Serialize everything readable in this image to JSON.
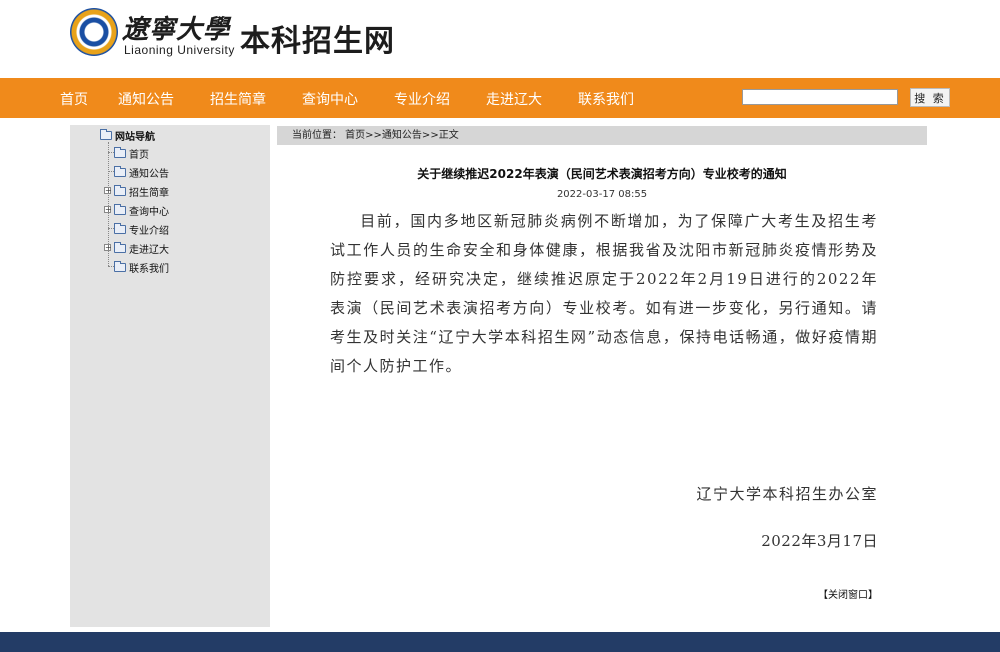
{
  "header": {
    "logo_cn": "遼寧大學",
    "logo_en": "Liaoning University",
    "site_title": "本科招生网"
  },
  "nav": {
    "items": [
      "首页",
      "通知公告",
      "招生简章",
      "查询中心",
      "专业介绍",
      "走进辽大",
      "联系我们"
    ],
    "search_placeholder": "",
    "search_button": "搜 索"
  },
  "sidebar": {
    "root": "网站导航",
    "items": [
      {
        "label": "首页",
        "expandable": false
      },
      {
        "label": "通知公告",
        "expandable": false
      },
      {
        "label": "招生简章",
        "expandable": true
      },
      {
        "label": "查询中心",
        "expandable": true
      },
      {
        "label": "专业介绍",
        "expandable": false
      },
      {
        "label": "走进辽大",
        "expandable": true
      },
      {
        "label": "联系我们",
        "expandable": false
      }
    ]
  },
  "breadcrumb": {
    "text": "当前位置： 首页>>通知公告>>正文"
  },
  "article": {
    "title": "关于继续推迟2022年表演（民间艺术表演招考方向）专业校考的通知",
    "date": "2022-03-17 08:55",
    "body": "目前，国内多地区新冠肺炎病例不断增加，为了保障广大考生及招生考试工作人员的生命安全和身体健康，根据我省及沈阳市新冠肺炎疫情形势及防控要求，经研究决定，继续推迟原定于2022年2月19日进行的2022年表演（民间艺术表演招考方向）专业校考。如有进一步变化，另行通知。请考生及时关注“辽宁大学本科招生网”动态信息，保持电话畅通，做好疫情期间个人防护工作。",
    "signature": "辽宁大学本科招生办公室",
    "sign_date": "2022年3月17日",
    "close_window": "【关闭窗口】"
  },
  "colors": {
    "nav_bg": "#f08a1b",
    "footer_bg": "#233c66",
    "sidebar_bg": "#e3e3e3",
    "breadcrumb_bg": "#d6d6d6"
  }
}
